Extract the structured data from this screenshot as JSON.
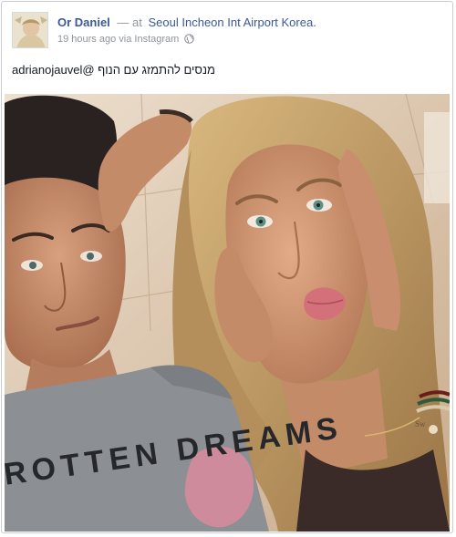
{
  "post": {
    "author": "Or Daniel",
    "separator": "—",
    "at": "at",
    "location": "Seoul Incheon Int Airport Korea.",
    "time": "19 hours ago",
    "via": "via",
    "source": "Instagram",
    "privacy_icon": "globe-icon",
    "caption_tag": "adrianojauvel@",
    "caption_text": "מנסים להתמזג עם הנוף"
  },
  "photo": {
    "shirt_print": "ROTTEN DREAMS",
    "bracelet_text": "Sw",
    "colors": {
      "background_wall": "#d8c3a9",
      "skin": "#c98e6d",
      "hair_blonde": "#c9a468",
      "hair_dark": "#2a2220",
      "shirt": "#8c8f93",
      "lips": "#d4707a",
      "eyes": "#5f8f83"
    }
  },
  "colors": {
    "link": "#3b5998",
    "meta": "#90949c",
    "text": "#141823",
    "border": "#c9ccd3"
  }
}
